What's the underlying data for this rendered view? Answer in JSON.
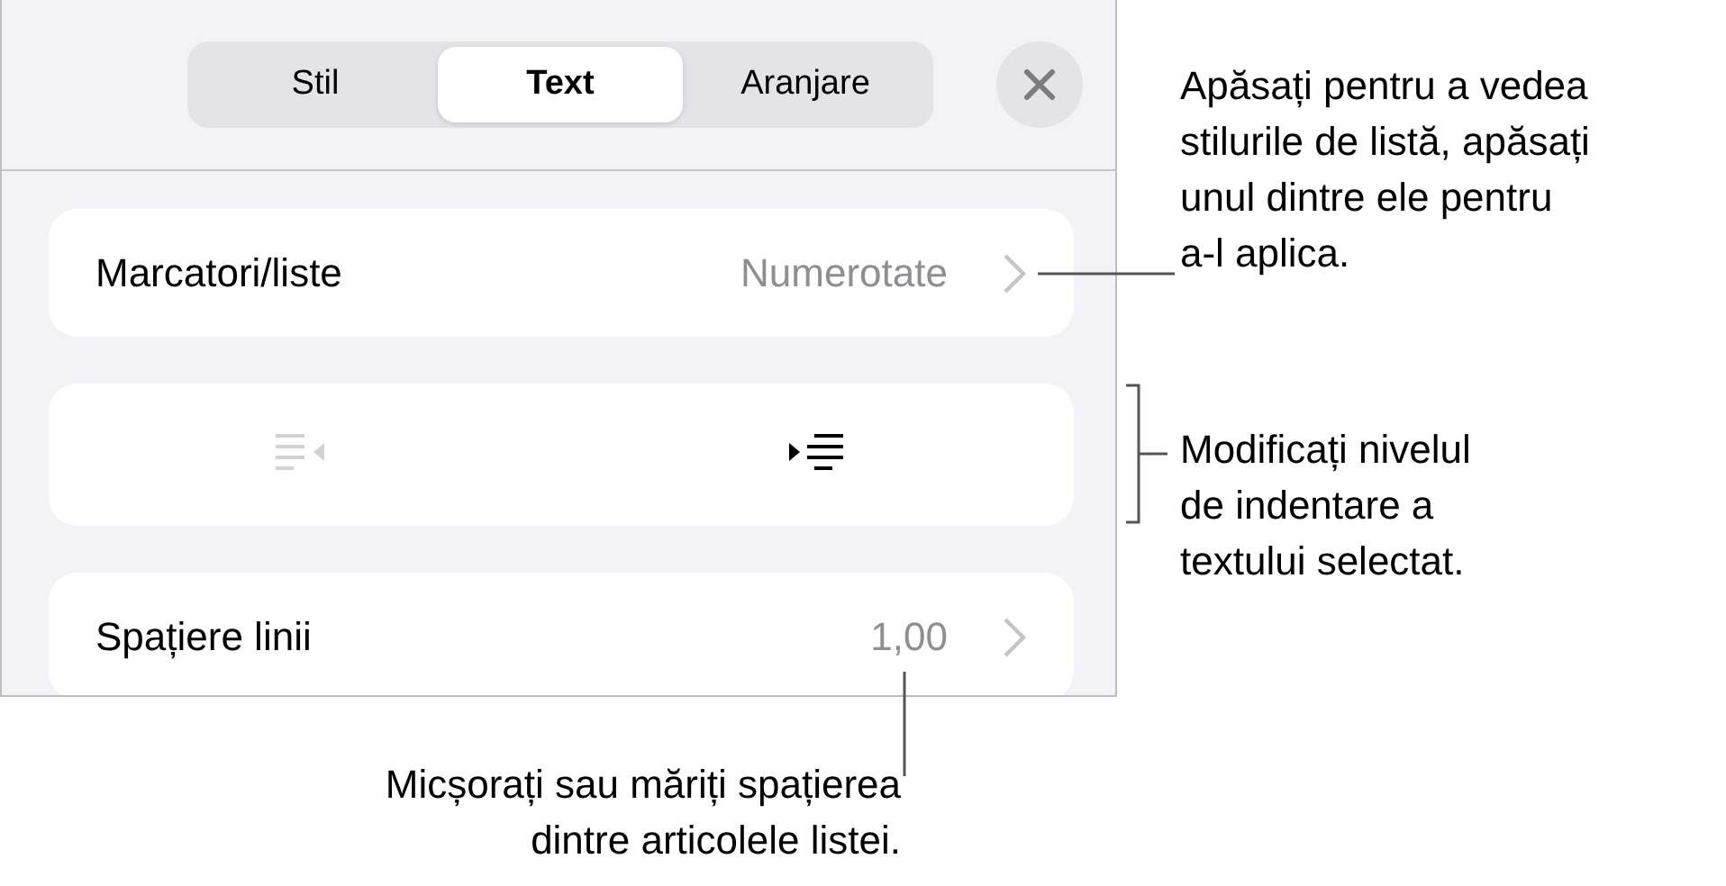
{
  "tabs": [
    {
      "label": "Stil",
      "selected": false
    },
    {
      "label": "Text",
      "selected": true
    },
    {
      "label": "Aranjare",
      "selected": false
    }
  ],
  "rows": [
    {
      "kind": "value",
      "label": "Marcatori/liste",
      "value": "Numerotate"
    },
    {
      "kind": "indent",
      "buttons": [
        {
          "kind": "decrease",
          "disabled": true
        },
        {
          "kind": "increase",
          "disabled": false
        }
      ]
    },
    {
      "kind": "value",
      "label": "Spațiere linii",
      "value": "1,00"
    }
  ],
  "callouts": [
    {
      "kind": "line",
      "lines": [
        "Apăsați pentru a vedea",
        "stilurile de listă, apăsați",
        "unul dintre ele pentru",
        "a-l aplica."
      ]
    },
    {
      "kind": "bracket",
      "lines": [
        "Modificați nivelul",
        "de indentare a",
        "textului selectat."
      ]
    },
    {
      "kind": "vertical",
      "lines": [
        "Micșorați sau măriți spațierea",
        "dintre articolele listei."
      ]
    }
  ]
}
